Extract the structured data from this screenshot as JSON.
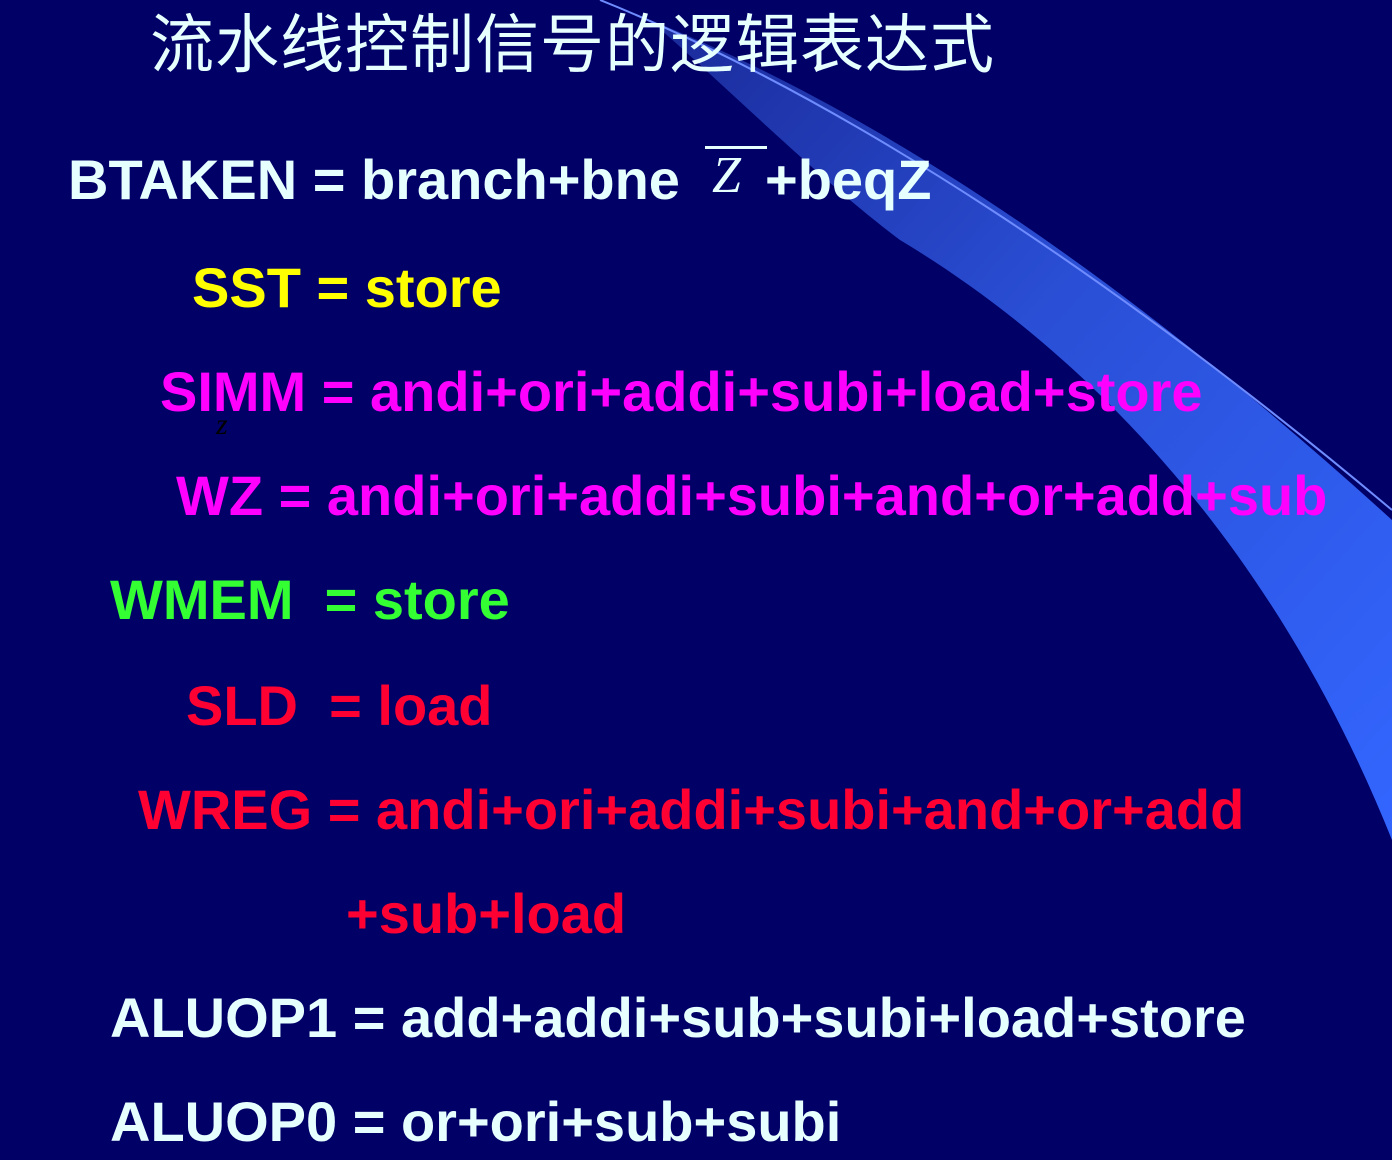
{
  "title": "流水线控制信号的逻辑表达式",
  "colors": {
    "background": "#000066",
    "light": "#e6ffff",
    "yellow": "#ffff00",
    "magenta": "#ff00ff",
    "green": "#33ff33",
    "red": "#ff0033",
    "accent_blue": "#3366ff"
  },
  "equations": {
    "btaken_prefix": "BTAKEN = branch+bne",
    "btaken_z": "Z",
    "btaken_suffix": "+beqZ",
    "sst": "SST = store",
    "simm": "SIMM = andi+ori+addi+subi+load+store",
    "simm_z": "z",
    "wz": "WZ = andi+ori+addi+subi+and+or+add+sub",
    "wmem": "WMEM  = store",
    "sld": "SLD  = load",
    "wreg_line1": "WREG = andi+ori+addi+subi+and+or+add",
    "wreg_line2": "+sub+load",
    "aluop1": "ALUOP1 = add+addi+sub+subi+load+store",
    "aluop0": "ALUOP0 = or+ori+sub+subi"
  }
}
